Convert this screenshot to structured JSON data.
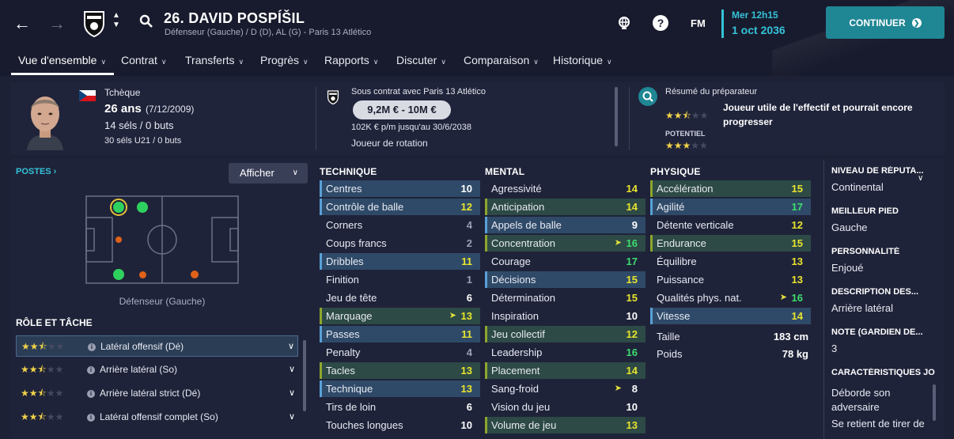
{
  "header": {
    "player_title": "26. DAVID POSPÍŠIL",
    "player_sub": "Défenseur (Gauche) / D (D), AL (G) - Paris 13 Atlético",
    "date_day": "Mer 12h15",
    "date_full": "1 oct 2036",
    "fm_label": "FM",
    "continue_label": "CONTINUER"
  },
  "tabs": [
    "Vue d'ensemble",
    "Contrat",
    "Transferts",
    "Progrès",
    "Rapports",
    "Discuter",
    "Comparaison",
    "Historique"
  ],
  "summary": {
    "nationality": "Tchèque",
    "age": "26 ans",
    "dob": "(7/12/2009)",
    "caps": "14 séls / 0 buts",
    "u21_caps": "30 séls U21 / 0 buts",
    "contract_with": "Sous contrat avec Paris 13 Atlético",
    "value": "9,2M € - 10M €",
    "wage": "102K € p/m jusqu'au 30/6/2038",
    "squad_status": "Joueur de rotation",
    "coach_title": "Résumé du préparateur",
    "coach_summary": "Joueur utile de l'effectif et pourrait encore progresser",
    "potential_label": "POTENTIEL",
    "current_ability_stars": 2.5,
    "potential_stars": 3
  },
  "positions": {
    "title": "POSTES",
    "show_label": "Afficher",
    "position_caption": "Défenseur (Gauche)"
  },
  "roles": {
    "title": "RÔLE ET TÂCHE",
    "items": [
      {
        "name": "Latéral offensif (Dé)",
        "stars": 2.5
      },
      {
        "name": "Arrière latéral (So)",
        "stars": 2.5
      },
      {
        "name": "Arrière latéral strict (Dé)",
        "stars": 2.5
      },
      {
        "name": "Latéral offensif complet (So)",
        "stars": 2.5
      }
    ]
  },
  "attributes": {
    "technique_title": "TECHNIQUE",
    "mental_title": "MENTAL",
    "physique_title": "PHYSIQUE",
    "technique": [
      {
        "name": "Centres",
        "value": "10",
        "hl": "b",
        "color": "w"
      },
      {
        "name": "Contrôle de balle",
        "value": "12",
        "hl": "b",
        "color": "y"
      },
      {
        "name": "Corners",
        "value": "4",
        "hl": "",
        "color": "g"
      },
      {
        "name": "Coups francs",
        "value": "2",
        "hl": "",
        "color": "g"
      },
      {
        "name": "Dribbles",
        "value": "11",
        "hl": "b",
        "color": "y"
      },
      {
        "name": "Finition",
        "value": "1",
        "hl": "",
        "color": "g"
      },
      {
        "name": "Jeu de tête",
        "value": "6",
        "hl": "",
        "color": "w"
      },
      {
        "name": "Marquage",
        "value": "13",
        "hl": "g",
        "color": "y",
        "arrow": true
      },
      {
        "name": "Passes",
        "value": "11",
        "hl": "b",
        "color": "y"
      },
      {
        "name": "Penalty",
        "value": "4",
        "hl": "",
        "color": "g"
      },
      {
        "name": "Tacles",
        "value": "13",
        "hl": "g",
        "color": "y"
      },
      {
        "name": "Technique",
        "value": "13",
        "hl": "b",
        "color": "y"
      },
      {
        "name": "Tirs de loin",
        "value": "6",
        "hl": "",
        "color": "w"
      },
      {
        "name": "Touches longues",
        "value": "10",
        "hl": "",
        "color": "w"
      }
    ],
    "mental": [
      {
        "name": "Agressivité",
        "value": "14",
        "hl": "",
        "color": "y"
      },
      {
        "name": "Anticipation",
        "value": "14",
        "hl": "g",
        "color": "y"
      },
      {
        "name": "Appels de balle",
        "value": "9",
        "hl": "b",
        "color": "w"
      },
      {
        "name": "Concentration",
        "value": "16",
        "hl": "g",
        "color": "gr",
        "arrow": true
      },
      {
        "name": "Courage",
        "value": "17",
        "hl": "",
        "color": "gr"
      },
      {
        "name": "Décisions",
        "value": "15",
        "hl": "b",
        "color": "y"
      },
      {
        "name": "Détermination",
        "value": "15",
        "hl": "",
        "color": "y"
      },
      {
        "name": "Inspiration",
        "value": "10",
        "hl": "",
        "color": "w"
      },
      {
        "name": "Jeu collectif",
        "value": "12",
        "hl": "g",
        "color": "y"
      },
      {
        "name": "Leadership",
        "value": "16",
        "hl": "",
        "color": "gr"
      },
      {
        "name": "Placement",
        "value": "14",
        "hl": "g",
        "color": "y"
      },
      {
        "name": "Sang-froid",
        "value": "8",
        "hl": "",
        "color": "w",
        "arrow": true
      },
      {
        "name": "Vision du jeu",
        "value": "10",
        "hl": "",
        "color": "w"
      },
      {
        "name": "Volume de jeu",
        "value": "13",
        "hl": "g",
        "color": "y"
      }
    ],
    "physique": [
      {
        "name": "Accélération",
        "value": "15",
        "hl": "g",
        "color": "y"
      },
      {
        "name": "Agilité",
        "value": "17",
        "hl": "b",
        "color": "gr"
      },
      {
        "name": "Détente verticale",
        "value": "12",
        "hl": "",
        "color": "y"
      },
      {
        "name": "Endurance",
        "value": "15",
        "hl": "g",
        "color": "y"
      },
      {
        "name": "Équilibre",
        "value": "13",
        "hl": "",
        "color": "y"
      },
      {
        "name": "Puissance",
        "value": "13",
        "hl": "",
        "color": "y"
      },
      {
        "name": "Qualités phys. nat.",
        "value": "16",
        "hl": "",
        "color": "gr",
        "arrow": true
      },
      {
        "name": "Vitesse",
        "value": "14",
        "hl": "b",
        "color": "y"
      }
    ],
    "height_label": "Taille",
    "height": "183 cm",
    "weight_label": "Poids",
    "weight": "78 kg"
  },
  "right_info": {
    "reputation_label": "NIVEAU DE RÉPUTA...",
    "reputation": "Continental",
    "foot_label": "MEILLEUR PIED",
    "foot": "Gauche",
    "personality_label": "PERSONNALITÉ",
    "personality": "Enjoué",
    "description_label": "DESCRIPTION DES...",
    "description": "Arrière latéral",
    "gk_label": "NOTE (GARDIEN DE...",
    "gk": "3",
    "traits_label": "CARACTÉRISTIQUES JO",
    "trait1": "Déborde son adversaire",
    "trait2": "Se retient de tirer de"
  },
  "colors": {
    "accent": "#1f8694",
    "date": "#35c2d9",
    "star": "#f0d24a",
    "blue_row": "#2f4a68",
    "green_row": "#2d4a46"
  }
}
